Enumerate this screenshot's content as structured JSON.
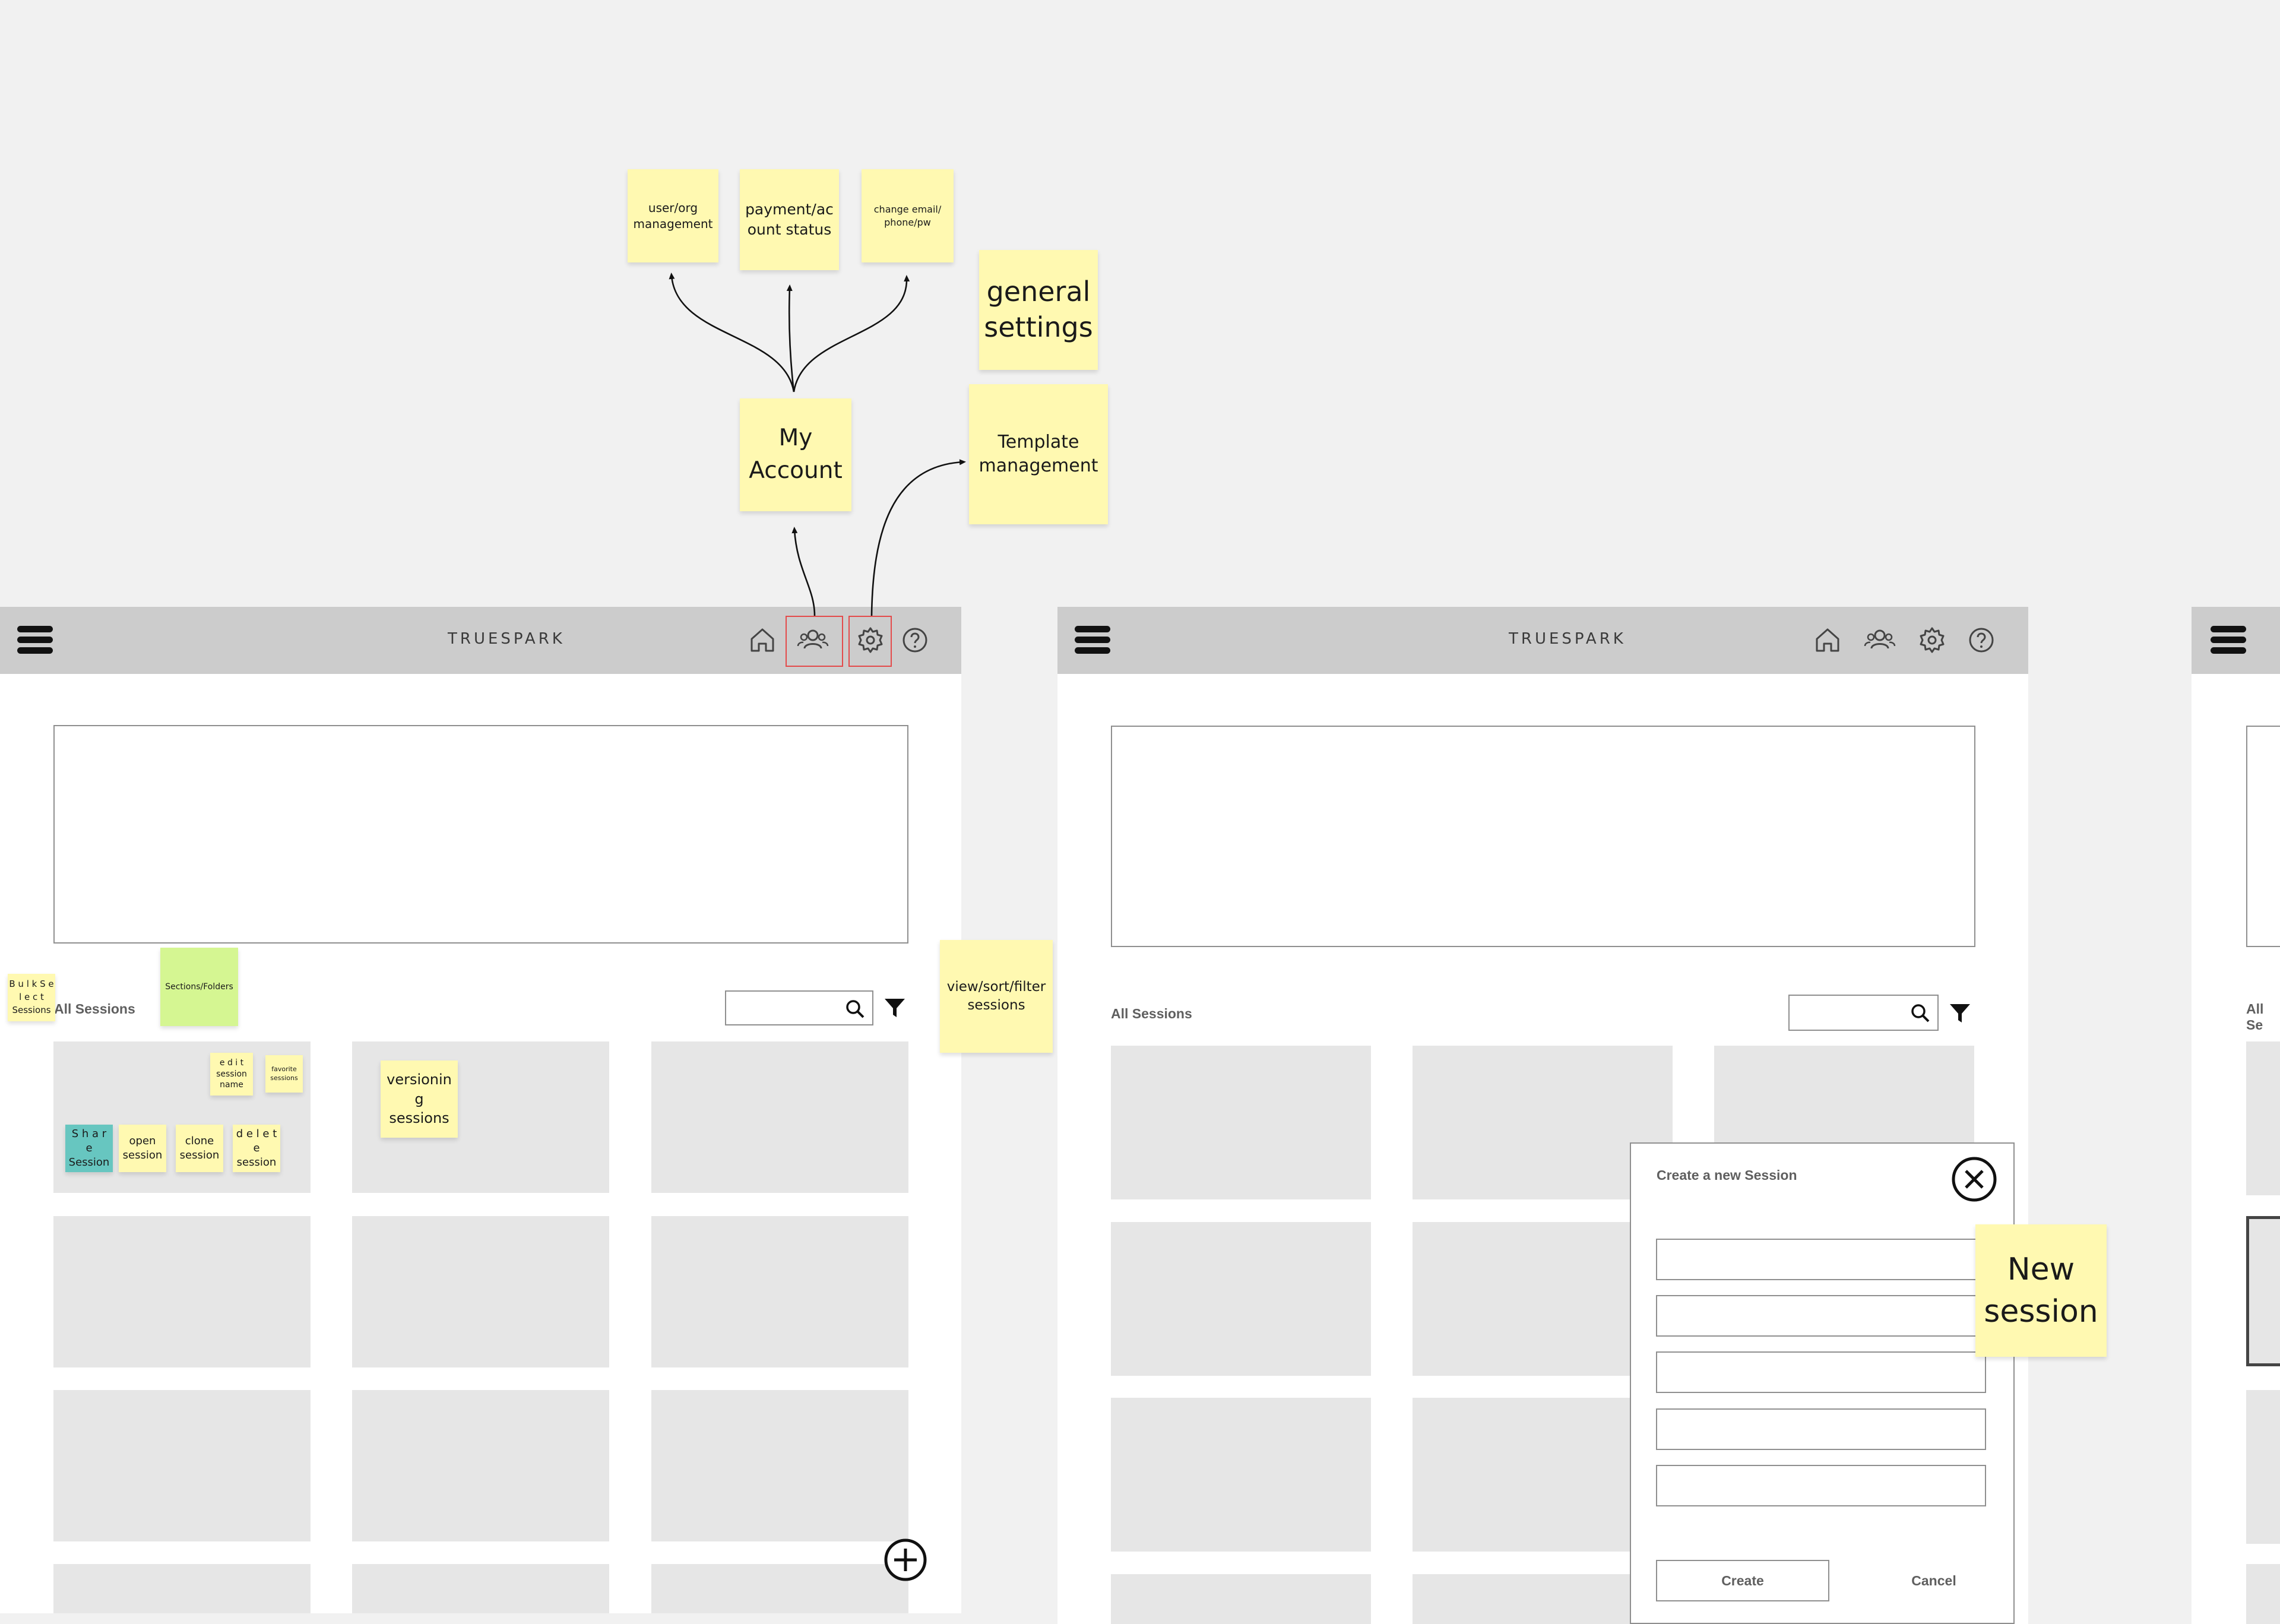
{
  "app": {
    "brand": "TRUESPARK"
  },
  "nav_icons": [
    "home-icon",
    "account-icon",
    "settings-icon",
    "help-icon"
  ],
  "frames": {
    "main": {
      "section_label": "All Sessions"
    },
    "second": {
      "section_label": "All Sessions"
    },
    "third": {
      "section_label": "All Se"
    }
  },
  "modal": {
    "title": "Create a new Session",
    "create_label": "Create",
    "cancel_label": "Cancel",
    "fields": [
      "",
      "",
      "",
      "",
      ""
    ]
  },
  "stickies": {
    "user_org": "user/org management",
    "payment": "payment/ac ount status",
    "change_email": "change email/ phone/pw",
    "general_settings": "general settings",
    "my_account": "My Account",
    "template_mgmt": "Template management",
    "view_sort_filter": "view/sort/filter sessions",
    "bulk_select": "B u l k S e l e c t Sessions",
    "sections_folders": "Sections/Folders",
    "edit_session_name": "e d i t session name",
    "favorite_sessions": "favorite sessions",
    "versioning": "versioning sessions",
    "share_session": "S h a r e Session",
    "open_session": "open session",
    "clone_session": "clone session",
    "delete_session": "d e l e t e session",
    "new_session": "New session"
  },
  "colors": {
    "canvas": "#f1f1f1",
    "navbar": "#cccccc",
    "sticky_yellow": "#fff9b1",
    "sticky_green": "#d5f692",
    "sticky_teal": "#67c6c0",
    "card": "#e6e6e6",
    "highlight": "#e34b4b"
  }
}
